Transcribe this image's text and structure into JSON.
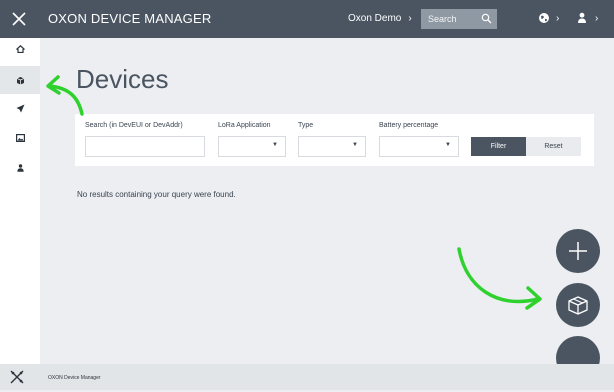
{
  "header": {
    "app_title": "OXON DEVICE MANAGER",
    "tenant": "Oxon Demo",
    "search_placeholder": "Search"
  },
  "main": {
    "page_title": "Devices",
    "filters": {
      "search_label": "Search (in DevEUI or DevAddr)",
      "lora_label": "LoRa Application",
      "type_label": "Type",
      "battery_label": "Battery percentage",
      "filter_button": "Filter",
      "reset_button": "Reset"
    },
    "empty_message": "No results containing your query were found."
  },
  "footer": {
    "label": "OXON Device Manager"
  },
  "colors": {
    "topbar": "#4a5561",
    "accent_arrow": "#2fd12f",
    "fab": "#4a5561"
  },
  "sidebar": {
    "items": [
      "home-icon",
      "devices-icon",
      "send-icon",
      "image-icon",
      "user-icon"
    ],
    "active": "devices-icon"
  },
  "fabs": [
    "plus-icon",
    "box-icon",
    "blank"
  ]
}
